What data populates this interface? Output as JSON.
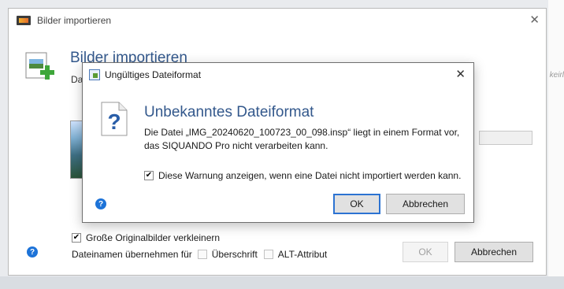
{
  "background": {
    "right_edge_text": "keirl"
  },
  "back_dialog": {
    "title": "Bilder importieren",
    "heading": "Bilder importieren",
    "subtext_truncated": "Da",
    "options": {
      "shrink_large": {
        "label": "Große Originalbilder verkleinern",
        "checked": true
      },
      "filename_label": "Dateinamen übernehmen für",
      "caption": {
        "label": "Überschrift",
        "checked": false
      },
      "alt": {
        "label": "ALT-Attribut",
        "checked": false
      }
    },
    "buttons": {
      "ok": "OK",
      "cancel": "Abbrechen"
    },
    "help_icon": "help-icon"
  },
  "error_dialog": {
    "title": "Ungültiges Dateiformat",
    "heading": "Unbekanntes Dateiformat",
    "message_line1": "Die Datei „IMG_20240620_100723_00_098.insp“ liegt in einem Format vor,",
    "message_line2": "das SIQUANDO Pro nicht verarbeiten kann.",
    "warning_checkbox": {
      "label": "Diese Warnung anzeigen, wenn eine Datei nicht importiert werden kann.",
      "checked": true
    },
    "buttons": {
      "ok": "OK",
      "cancel": "Abbrechen"
    },
    "icons": [
      "question-document-icon",
      "help-icon",
      "close-icon"
    ]
  },
  "colors": {
    "heading_blue": "#33588c",
    "focus_blue": "#2c73d2",
    "help_blue": "#1d73d8"
  }
}
